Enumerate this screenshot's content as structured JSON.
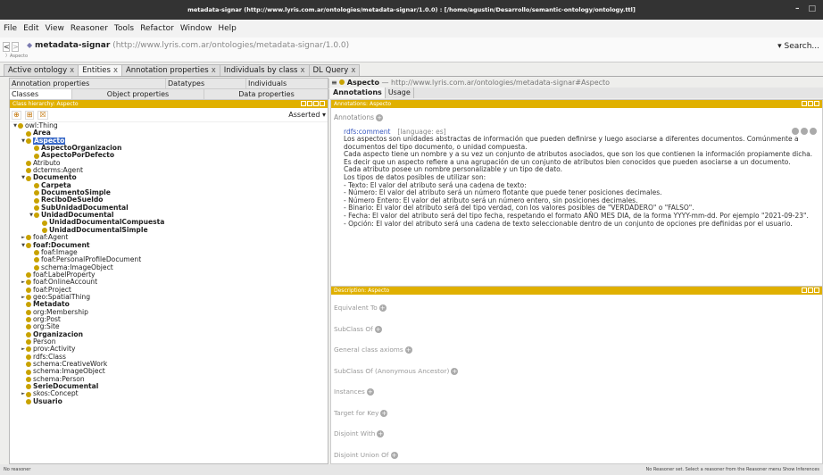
{
  "window": {
    "title": "metadata-signar (http://www.lyris.com.ar/ontologies/metadata-signar/1.0.0) : [/home/agustin/Desarrollo/semantic-ontology/ontology.ttl]"
  },
  "menu": [
    "File",
    "Edit",
    "View",
    "Reasoner",
    "Tools",
    "Refactor",
    "Window",
    "Help"
  ],
  "address": {
    "name": "metadata-signar",
    "iri": "(http://www.lyris.com.ar/ontologies/metadata-signar/1.0.0)",
    "breadcrumb": "Aspecto",
    "search_label": "Search..."
  },
  "tabs": [
    {
      "label": "Active ontology"
    },
    {
      "label": "Entities"
    },
    {
      "label": "Annotation properties"
    },
    {
      "label": "Individuals by class"
    },
    {
      "label": "DL Query"
    }
  ],
  "left": {
    "subtabs_row1": [
      "Annotation properties",
      "Datatypes",
      "Individuals"
    ],
    "subtabs_row2": [
      "Classes",
      "Object properties",
      "Data properties"
    ],
    "header": "Class hierarchy: Aspecto",
    "asserted": "Asserted",
    "tree": [
      {
        "label": "owl:Thing",
        "lvl": 0,
        "tog": "▼",
        "bold": false
      },
      {
        "label": "Area",
        "lvl": 1,
        "tog": "",
        "bold": true
      },
      {
        "label": "Aspecto",
        "lvl": 1,
        "tog": "▼",
        "bold": true,
        "sel": true
      },
      {
        "label": "AspectoOrganizacion",
        "lvl": 2,
        "tog": "",
        "bold": true
      },
      {
        "label": "AspectoPorDefecto",
        "lvl": 2,
        "tog": "",
        "bold": true
      },
      {
        "label": "Atributo",
        "lvl": 1,
        "tog": "",
        "bold": false
      },
      {
        "label": "dcterms:Agent",
        "lvl": 1,
        "tog": "",
        "bold": false
      },
      {
        "label": "Documento",
        "lvl": 1,
        "tog": "▼",
        "bold": true
      },
      {
        "label": "Carpeta",
        "lvl": 2,
        "tog": "",
        "bold": true
      },
      {
        "label": "DocumentoSimple",
        "lvl": 2,
        "tog": "",
        "bold": true
      },
      {
        "label": "ReciboDeSueldo",
        "lvl": 2,
        "tog": "",
        "bold": true
      },
      {
        "label": "SubUnidadDocumental",
        "lvl": 2,
        "tog": "",
        "bold": true
      },
      {
        "label": "UnidadDocumental",
        "lvl": 2,
        "tog": "▼",
        "bold": true
      },
      {
        "label": "UnidadDocumentalCompuesta",
        "lvl": 3,
        "tog": "",
        "bold": true
      },
      {
        "label": "UnidadDocumentalSimple",
        "lvl": 3,
        "tog": "",
        "bold": true
      },
      {
        "label": "foaf:Agent",
        "lvl": 1,
        "tog": "►",
        "bold": false
      },
      {
        "label": "foaf:Document",
        "lvl": 1,
        "tog": "▼",
        "bold": true
      },
      {
        "label": "foaf:Image",
        "lvl": 2,
        "tog": "",
        "bold": false
      },
      {
        "label": "foaf:PersonalProfileDocument",
        "lvl": 2,
        "tog": "",
        "bold": false
      },
      {
        "label": "schema:ImageObject",
        "lvl": 2,
        "tog": "",
        "bold": false
      },
      {
        "label": "foaf:LabelProperty",
        "lvl": 1,
        "tog": "",
        "bold": false
      },
      {
        "label": "foaf:OnlineAccount",
        "lvl": 1,
        "tog": "►",
        "bold": false
      },
      {
        "label": "foaf:Project",
        "lvl": 1,
        "tog": "",
        "bold": false
      },
      {
        "label": "geo:SpatialThing",
        "lvl": 1,
        "tog": "►",
        "bold": false
      },
      {
        "label": "Metadato",
        "lvl": 1,
        "tog": "",
        "bold": true
      },
      {
        "label": "org:Membership",
        "lvl": 1,
        "tog": "",
        "bold": false
      },
      {
        "label": "org:Post",
        "lvl": 1,
        "tog": "",
        "bold": false
      },
      {
        "label": "org:Site",
        "lvl": 1,
        "tog": "",
        "bold": false
      },
      {
        "label": "Organizacion",
        "lvl": 1,
        "tog": "",
        "bold": true
      },
      {
        "label": "Person",
        "lvl": 1,
        "tog": "",
        "bold": false
      },
      {
        "label": "prov:Activity",
        "lvl": 1,
        "tog": "►",
        "bold": false
      },
      {
        "label": "rdfs:Class",
        "lvl": 1,
        "tog": "",
        "bold": false
      },
      {
        "label": "schema:CreativeWork",
        "lvl": 1,
        "tog": "",
        "bold": false
      },
      {
        "label": "schema:ImageObject",
        "lvl": 1,
        "tog": "",
        "bold": false
      },
      {
        "label": "schema:Person",
        "lvl": 1,
        "tog": "",
        "bold": false
      },
      {
        "label": "SerieDocumental",
        "lvl": 1,
        "tog": "",
        "bold": true
      },
      {
        "label": "skos:Concept",
        "lvl": 1,
        "tog": "►",
        "bold": false
      },
      {
        "label": "Usuario",
        "lvl": 1,
        "tog": "",
        "bold": true
      }
    ]
  },
  "right": {
    "entity_name": "Aspecto",
    "entity_iri": "— http://www.lyris.com.ar/ontologies/metadata-signar#Aspecto",
    "tabs": [
      "Annotations",
      "Usage"
    ],
    "ann_header": "Annotations: Aspecto",
    "ann_section": "Annotations",
    "ann_prop": "rdfs:comment",
    "ann_lang": "[language: es]",
    "comment_lines": [
      "Los aspectos son unidades abstractas de información que pueden definirse y luego asociarse a diferentes documentos. Comúnmente a documentos del tipo documento, o unidad compuesta.",
      "Cada aspecto tiene un nombre y a su vez un conjunto de atributos asociados, que son los que contienen la información propiamente dicha. Es decir que un aspecto refiere a una agrupación de un conjunto de atributos bien conocidos que pueden asociarse a un documento.",
      "Cada atributo posee un nombre personalizable y un tipo de dato.",
      "Los tipos de datos posibles de utilizar son:",
      "- Texto: El valor del atributo será una cadena de texto:",
      "- Número: El valor del atributo será un número flotante que puede tener posiciones decimales.",
      "- Número Entero: El valor del atributo será un número entero, sin posiciones decimales.",
      "- Binario: El valor del atributo será del tipo verdad, con los valores posibles de \"VERDADERO\" o \"FALSO\".",
      "- Fecha: El valor del atributo será del tipo fecha, respetando el formato AÑO MES DIA, de la forma YYYY-mm-dd. Por ejemplo \"2021-09-23\".",
      "- Opción: El valor del atributo será una cadena de texto seleccionable dentro de un conjunto de opciones pre definidas por el usuario."
    ],
    "desc_header": "Description: Aspecto",
    "desc_sections": [
      "Equivalent To",
      "SubClass Of",
      "General class axioms",
      "SubClass Of (Anonymous Ancestor)",
      "Instances",
      "Target for Key",
      "Disjoint With",
      "Disjoint Union Of"
    ]
  },
  "status": {
    "left": "No reasoner",
    "right": "No Reasoner set. Select a reasoner from the Reasoner menu   Show Inferences"
  }
}
